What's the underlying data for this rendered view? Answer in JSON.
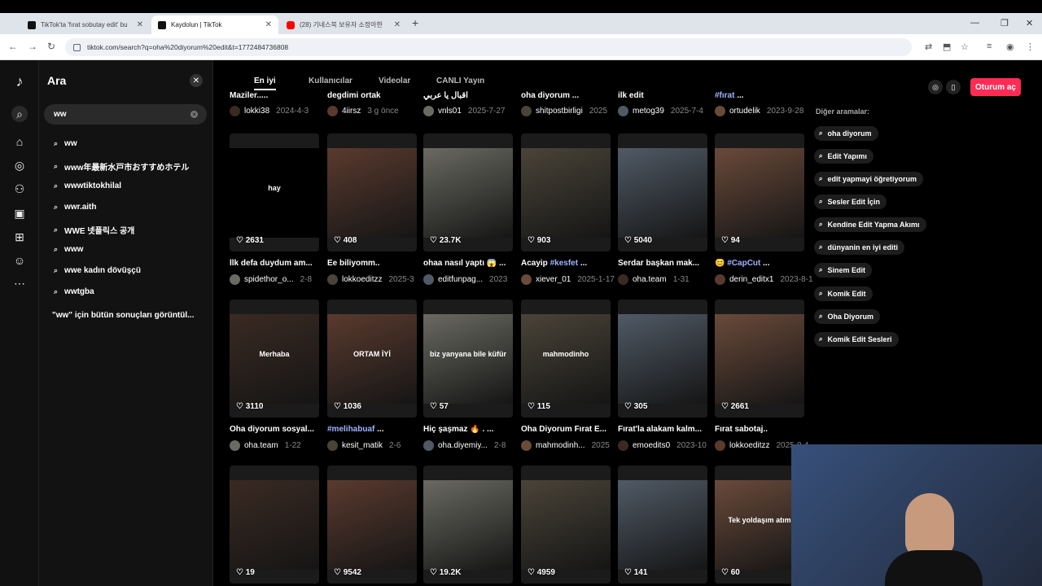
{
  "browser": {
    "tabs": [
      {
        "title": "TikTok'ta 'fırat sobutay edit' bu",
        "active": false,
        "color": "#111111"
      },
      {
        "title": "Kaydolun | TikTok",
        "active": true,
        "color": "#111111"
      },
      {
        "title": "(28) 기네스북 보유자 소정아한",
        "active": false,
        "color": "#ff0000"
      }
    ],
    "url": "tiktok.com/search?q=oha%20diyorum%20edit&t=1772484736808"
  },
  "search_panel": {
    "title": "Ara",
    "input_value": "ww",
    "suggestions": [
      "ww",
      "www年最新水戸市おすすめホテル",
      "wwwtiktokhilal",
      "wwr.aith",
      "WWE 넷플릭스 공개",
      "www",
      "wwe kadın dövüşçü",
      "wwtgba"
    ],
    "all_results": "\"ww\" için bütün sonuçları görüntül..."
  },
  "main_tabs": [
    "En iyi",
    "Kullanıcılar",
    "Videolar",
    "CANLI Yayın"
  ],
  "login_label": "Oturum aç",
  "other_searches": {
    "heading": "Diğer aramalar:",
    "items": [
      "oha diyorum",
      "Edit Yapımı",
      "edit yapmayi öğretiyorum",
      "Sesler Edit İçin",
      "Kendine Edit Yapma Akımı",
      "dünyanin en iyi editi",
      "Sinem Edit",
      "Komik Edit",
      "Oha Diyorum",
      "Komik Edit Sesleri"
    ]
  },
  "top_row": [
    {
      "caption": "Maziler.....",
      "author": "lokki38",
      "date": "2024-4-3"
    },
    {
      "caption": "degdimi ortak",
      "author": "4iirsz",
      "date": "3 g önce"
    },
    {
      "caption": "اقبال يا عربي",
      "author": "vnls01",
      "date": "2025-7-27"
    },
    {
      "caption": "oha diyorum ...",
      "author": "shitpostbirligi",
      "date": "2025"
    },
    {
      "caption": "ilk edit",
      "author": "metog39",
      "date": "2025-7-4"
    },
    {
      "caption": "#fırat ...",
      "author": "ortudelik",
      "date": "2023-9-28"
    }
  ],
  "row1": [
    {
      "likes": "2631",
      "caption": "İlk defa duydum am...",
      "author": "spidethor_o...",
      "date": "2-8",
      "overlay": "hay"
    },
    {
      "likes": "408",
      "caption": "Ee biliyomm..",
      "author": "lokkoeditzz",
      "date": "2025-3",
      "overlay": ""
    },
    {
      "likes": "23.7K",
      "caption": "ohaa nasıl yaptı 😱 ...",
      "author": "editfunpag...",
      "date": "2023",
      "overlay": ""
    },
    {
      "likes": "903",
      "caption": "Acayip #kesfet ...",
      "author": "xiever_01",
      "date": "2025-1-17",
      "overlay": ""
    },
    {
      "likes": "5040",
      "caption": "Serdar başkan mak...",
      "author": "oha.team",
      "date": "1-31",
      "overlay": ""
    },
    {
      "likes": "94",
      "caption": "😊 #CapCut ...",
      "author": "derin_editx1",
      "date": "2023-8-15",
      "overlay": ""
    }
  ],
  "row2": [
    {
      "likes": "3110",
      "caption": "Oha diyorum sosyal...",
      "author": "oha.team",
      "date": "1-22",
      "overlay": "Merhaba"
    },
    {
      "likes": "1036",
      "caption": "#melihabuaf ...",
      "author": "kesit_matik",
      "date": "2-6",
      "overlay": "ORTAM İYİ"
    },
    {
      "likes": "57",
      "caption": "Hiç şaşmaz 🔥 . ...",
      "author": "oha.diyemiy...",
      "date": "2-8",
      "overlay": "biz yanyana bile küfür"
    },
    {
      "likes": "115",
      "caption": "Oha Diyorum Fırat E...",
      "author": "mahmodinh...",
      "date": "2025",
      "overlay": "mahmodinho"
    },
    {
      "likes": "305",
      "caption": "Fırat'la alakam kalm...",
      "author": "emoedits0",
      "date": "2023-10",
      "overlay": ""
    },
    {
      "likes": "2661",
      "caption": "Fırat sabotaj..",
      "author": "lokkoeditzz",
      "date": "2025-8-4",
      "overlay": ""
    }
  ],
  "row3": [
    {
      "likes": "19",
      "overlay": ""
    },
    {
      "likes": "9542",
      "overlay": ""
    },
    {
      "likes": "19.2K",
      "overlay": ""
    },
    {
      "likes": "4959",
      "overlay": ""
    },
    {
      "likes": "141",
      "overlay": ""
    },
    {
      "likes": "60",
      "overlay": "Tek yoldaşım atım"
    }
  ],
  "colors": {
    "accent": "#fe2c55",
    "hashtag": "#9fb3ff"
  }
}
